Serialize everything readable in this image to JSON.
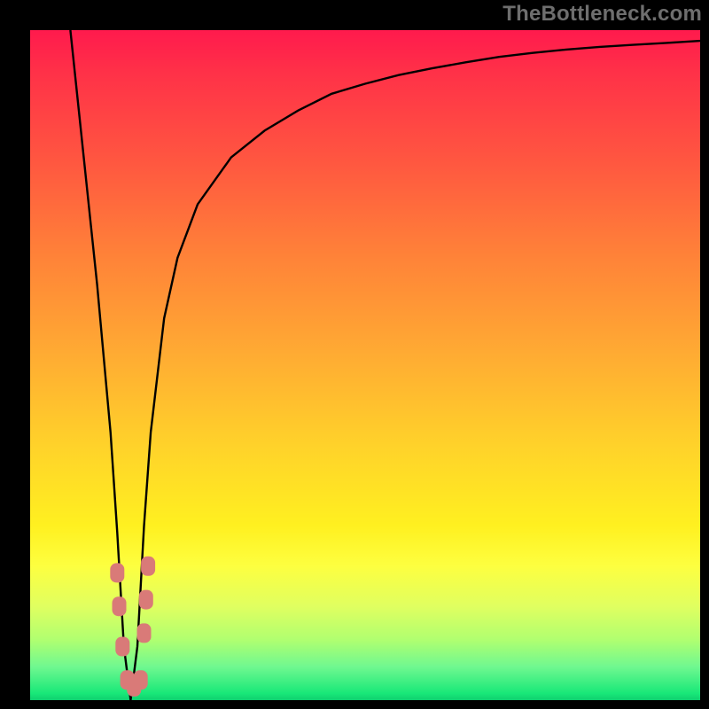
{
  "watermark": "TheBottleneck.com",
  "chart_data": {
    "type": "line",
    "title": "",
    "xlabel": "",
    "ylabel": "",
    "xlim": [
      0,
      100
    ],
    "ylim": [
      0,
      100
    ],
    "series": [
      {
        "name": "curve",
        "x": [
          6,
          8,
          10,
          12,
          13,
          14,
          15,
          16,
          17,
          18,
          20,
          22,
          25,
          30,
          35,
          40,
          45,
          50,
          55,
          60,
          65,
          70,
          75,
          80,
          85,
          90,
          95,
          100
        ],
        "values": [
          100,
          81,
          62,
          40,
          25,
          8,
          0,
          8,
          26,
          40,
          57,
          66,
          74,
          81,
          85,
          88,
          90.5,
          92,
          93.3,
          94.3,
          95.2,
          96,
          96.6,
          97.1,
          97.5,
          97.8,
          98.1,
          98.4
        ]
      }
    ],
    "markers": [
      {
        "x": 13.0,
        "y": 19
      },
      {
        "x": 13.3,
        "y": 14
      },
      {
        "x": 13.8,
        "y": 8
      },
      {
        "x": 14.5,
        "y": 3
      },
      {
        "x": 15.5,
        "y": 2
      },
      {
        "x": 16.5,
        "y": 3
      },
      {
        "x": 17.0,
        "y": 10
      },
      {
        "x": 17.3,
        "y": 15
      },
      {
        "x": 17.6,
        "y": 20
      }
    ],
    "marker_color": "#d97a78",
    "curve_color": "#000000"
  }
}
